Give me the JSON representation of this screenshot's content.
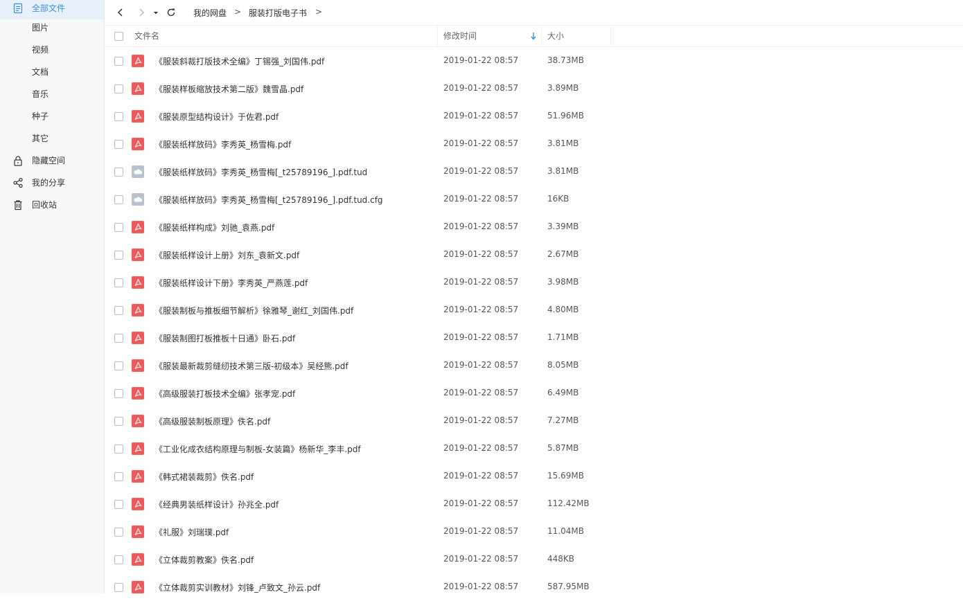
{
  "sidebar": {
    "items": [
      {
        "label": "全部文件",
        "icon": "document-icon",
        "active": true
      },
      {
        "label": "图片"
      },
      {
        "label": "视频"
      },
      {
        "label": "文档"
      },
      {
        "label": "音乐"
      },
      {
        "label": "种子"
      },
      {
        "label": "其它"
      },
      {
        "label": "隐藏空间",
        "icon": "lock-icon"
      },
      {
        "label": "我的分享",
        "icon": "share-icon"
      },
      {
        "label": "回收站",
        "icon": "trash-icon"
      }
    ]
  },
  "breadcrumb": {
    "root": "我的网盘",
    "folder": "服装打版电子书",
    "sep": ">"
  },
  "columns": {
    "name": "文件名",
    "modified": "修改时间",
    "size": "大小"
  },
  "colors": {
    "accent": "#3a8ee6",
    "pdf": "#f05a5a",
    "cloud": "#b9c3cf"
  },
  "files": [
    {
      "name": "《服装斜裁打版技术全编》丁锡强_刘国伟.pdf",
      "date": "2019-01-22 08:57",
      "size": "38.73MB",
      "type": "pdf"
    },
    {
      "name": "《服装样板缩放技术第二版》魏雪晶.pdf",
      "date": "2019-01-22 08:57",
      "size": "3.89MB",
      "type": "pdf"
    },
    {
      "name": "《服装原型结构设计》于佐君.pdf",
      "date": "2019-01-22 08:57",
      "size": "51.96MB",
      "type": "pdf"
    },
    {
      "name": "《服装纸样放码》李秀英_杨雪梅.pdf",
      "date": "2019-01-22 08:57",
      "size": "3.81MB",
      "type": "pdf"
    },
    {
      "name": "《服装纸样放码》李秀英_杨雪梅[_t25789196_].pdf.tud",
      "date": "2019-01-22 08:57",
      "size": "3.81MB",
      "type": "cloud"
    },
    {
      "name": "《服装纸样放码》李秀英_杨雪梅[_t25789196_].pdf.tud.cfg",
      "date": "2019-01-22 08:57",
      "size": "16KB",
      "type": "cloud"
    },
    {
      "name": "《服装纸样构成》刘驰_袁燕.pdf",
      "date": "2019-01-22 08:57",
      "size": "3.39MB",
      "type": "pdf"
    },
    {
      "name": "《服装纸样设计上册》刘东_袁新文.pdf",
      "date": "2019-01-22 08:57",
      "size": "2.67MB",
      "type": "pdf"
    },
    {
      "name": "《服装纸样设计下册》李秀英_严燕莲.pdf",
      "date": "2019-01-22 08:57",
      "size": "3.98MB",
      "type": "pdf"
    },
    {
      "name": "《服装制板与推板细节解析》徐雅琴_谢红_刘国伟.pdf",
      "date": "2019-01-22 08:57",
      "size": "4.80MB",
      "type": "pdf"
    },
    {
      "name": "《服装制图打板推板十日通》卧石.pdf",
      "date": "2019-01-22 08:57",
      "size": "1.71MB",
      "type": "pdf"
    },
    {
      "name": "《服装最新裁剪缝纫技术第三版-初级本》吴经熊.pdf",
      "date": "2019-01-22 08:57",
      "size": "8.05MB",
      "type": "pdf"
    },
    {
      "name": "《高级服装打板技术全编》张孝宠.pdf",
      "date": "2019-01-22 08:57",
      "size": "6.49MB",
      "type": "pdf"
    },
    {
      "name": "《高级服装制板原理》佚名.pdf",
      "date": "2019-01-22 08:57",
      "size": "7.27MB",
      "type": "pdf"
    },
    {
      "name": "《工业化成衣结构原理与制板-女装篇》杨新华_李丰.pdf",
      "date": "2019-01-22 08:57",
      "size": "5.87MB",
      "type": "pdf"
    },
    {
      "name": "《韩式裙装裁剪》佚名.pdf",
      "date": "2019-01-22 08:57",
      "size": "15.69MB",
      "type": "pdf"
    },
    {
      "name": "《经典男装纸样设计》孙兆全.pdf",
      "date": "2019-01-22 08:57",
      "size": "112.42MB",
      "type": "pdf"
    },
    {
      "name": "《礼服》刘瑞璞.pdf",
      "date": "2019-01-22 08:57",
      "size": "11.04MB",
      "type": "pdf"
    },
    {
      "name": "《立体裁剪教案》佚名.pdf",
      "date": "2019-01-22 08:57",
      "size": "448KB",
      "type": "pdf"
    },
    {
      "name": "《立体裁剪实训教材》刘锋_卢致文_孙云.pdf",
      "date": "2019-01-22 08:57",
      "size": "587.95MB",
      "type": "pdf"
    }
  ]
}
